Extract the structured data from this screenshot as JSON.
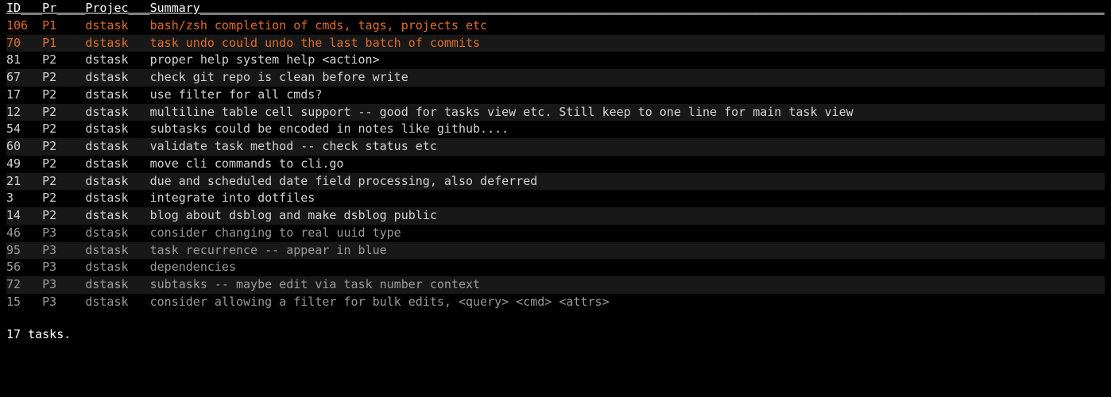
{
  "columns": {
    "id": "ID",
    "pr": "Pr",
    "project": "Projec",
    "summary": "Summary"
  },
  "tasks": [
    {
      "id": "106",
      "pr": "P1",
      "project": "dstask",
      "summary": "bash/zsh completion of cmds, tags, projects etc"
    },
    {
      "id": "70",
      "pr": "P1",
      "project": "dstask",
      "summary": "task undo could undo the last batch of commits"
    },
    {
      "id": "81",
      "pr": "P2",
      "project": "dstask",
      "summary": "proper help system help <action>"
    },
    {
      "id": "67",
      "pr": "P2",
      "project": "dstask",
      "summary": "check git repo is clean before write"
    },
    {
      "id": "17",
      "pr": "P2",
      "project": "dstask",
      "summary": "use filter for all cmds?"
    },
    {
      "id": "12",
      "pr": "P2",
      "project": "dstask",
      "summary": "multiline table cell support -- good for tasks view etc. Still keep to one line for main task view"
    },
    {
      "id": "54",
      "pr": "P2",
      "project": "dstask",
      "summary": "subtasks could be encoded in notes like github...."
    },
    {
      "id": "60",
      "pr": "P2",
      "project": "dstask",
      "summary": "validate task method -- check status etc"
    },
    {
      "id": "49",
      "pr": "P2",
      "project": "dstask",
      "summary": "move cli commands to cli.go"
    },
    {
      "id": "21",
      "pr": "P2",
      "project": "dstask",
      "summary": "due and scheduled date field processing, also deferred"
    },
    {
      "id": "3",
      "pr": "P2",
      "project": "dstask",
      "summary": "integrate into dotfiles"
    },
    {
      "id": "14",
      "pr": "P2",
      "project": "dstask",
      "summary": "blog about dsblog and make dsblog public"
    },
    {
      "id": "46",
      "pr": "P3",
      "project": "dstask",
      "summary": "consider changing to real uuid type"
    },
    {
      "id": "95",
      "pr": "P3",
      "project": "dstask",
      "summary": "task recurrence -- appear in blue"
    },
    {
      "id": "56",
      "pr": "P3",
      "project": "dstask",
      "summary": "dependencies"
    },
    {
      "id": "72",
      "pr": "P3",
      "project": "dstask",
      "summary": "subtasks -- maybe edit via task number context"
    },
    {
      "id": "15",
      "pr": "P3",
      "project": "dstask",
      "summary": "consider allowing a filter for bulk edits, <query> <cmd> <attrs>"
    }
  ],
  "footer": "17 tasks.",
  "col_widths": {
    "id": 5,
    "pr": 6,
    "project": 9
  },
  "header_dash_total": 153
}
